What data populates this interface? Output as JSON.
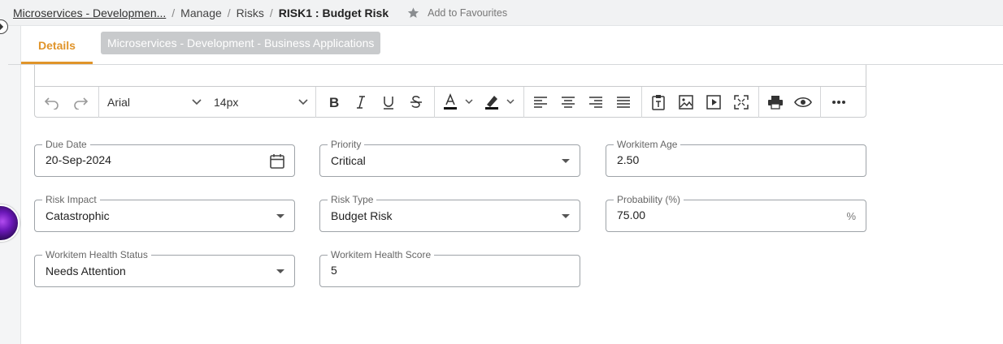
{
  "breadcrumb": {
    "project": "Microservices - Developmen...",
    "manage": "Manage",
    "risks": "Risks",
    "current": "RISK1 : Budget Risk",
    "separator": "/"
  },
  "favourite": {
    "label": "Add to Favourites",
    "icon": "star-icon"
  },
  "tabs": {
    "details": "Details",
    "context_chip": "Microservices - Development - Business Applications"
  },
  "toolbar": {
    "font_family": "Arial",
    "font_size": "14px",
    "buttons": [
      "undo-icon",
      "redo-icon",
      "bold-icon",
      "italic-icon",
      "underline-icon",
      "strikethrough-icon",
      "font-color-icon",
      "highlight-color-icon",
      "align-left-icon",
      "align-center-icon",
      "align-right-icon",
      "justify-icon",
      "paste-text-icon",
      "image-icon",
      "video-icon",
      "fullscreen-icon",
      "print-icon",
      "preview-icon",
      "more-icon"
    ]
  },
  "fields": {
    "due_date": {
      "label": "Due Date",
      "value": "20-Sep-2024"
    },
    "priority": {
      "label": "Priority",
      "value": "Critical"
    },
    "workitem_age": {
      "label": "Workitem Age",
      "value": "2.50"
    },
    "risk_impact": {
      "label": "Risk Impact",
      "value": "Catastrophic"
    },
    "risk_type": {
      "label": "Risk Type",
      "value": "Budget Risk"
    },
    "probability": {
      "label": "Probability (%)",
      "value": "75.00",
      "suffix": "%"
    },
    "health_status": {
      "label": "Workitem Health Status",
      "value": "Needs Attention"
    },
    "health_score": {
      "label": "Workitem Health Score",
      "value": "5"
    }
  },
  "colors": {
    "accent": "#e0942a",
    "chip_bg": "#c8cacc",
    "field_border": "#9ea3a8"
  }
}
